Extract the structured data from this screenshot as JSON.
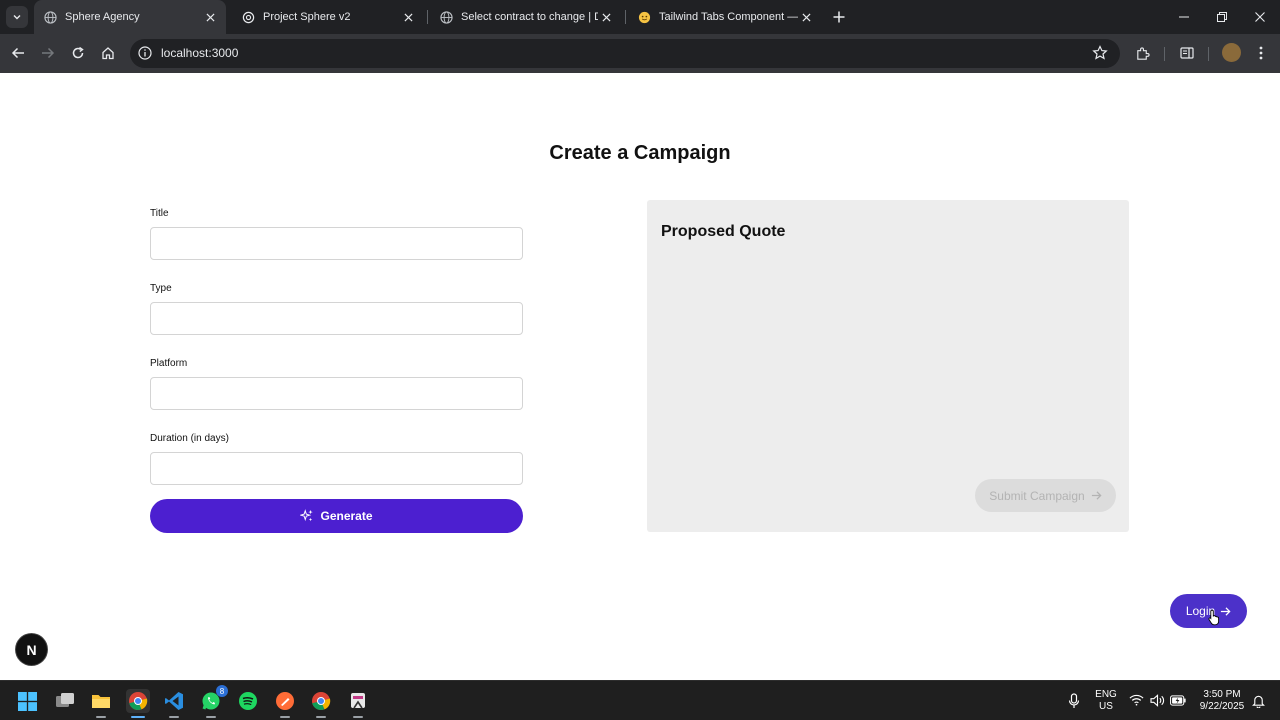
{
  "browser": {
    "tabs": [
      {
        "title": "Sphere Agency",
        "active": true,
        "favicon": "globe-icon"
      },
      {
        "title": "Project Sphere v2",
        "active": false,
        "favicon": "openai-icon"
      },
      {
        "title": "Select contract to change | Djan",
        "active": false,
        "favicon": "globe-icon"
      },
      {
        "title": "Tailwind Tabs Component — Ta",
        "active": false,
        "favicon": "emoji-icon"
      }
    ],
    "url": "localhost:3000"
  },
  "page": {
    "title": "Create a Campaign",
    "form": {
      "title_label": "Title",
      "title_value": "",
      "type_label": "Type",
      "type_value": "",
      "platform_label": "Platform",
      "platform_value": "",
      "duration_label": "Duration (in days)",
      "duration_value": "",
      "generate_label": "Generate"
    },
    "quote": {
      "heading": "Proposed Quote",
      "submit_label": "Submit Campaign"
    },
    "login_label": "Login",
    "next_badge": "N"
  },
  "taskbar": {
    "apps": [
      "start-icon",
      "task-view-icon",
      "file-explorer-icon",
      "chrome-icon",
      "vscode-icon",
      "whatsapp-icon",
      "spotify-icon",
      "postman-icon",
      "chrome-icon",
      "snipping-tool-icon"
    ],
    "whatsapp_badge": "8",
    "lang_top": "ENG",
    "lang_bottom": "US",
    "time": "3:50 PM",
    "date": "9/22/2025"
  },
  "colors": {
    "accent": "#4c1fd0",
    "login": "#4c31c9",
    "panel": "#ededed"
  }
}
